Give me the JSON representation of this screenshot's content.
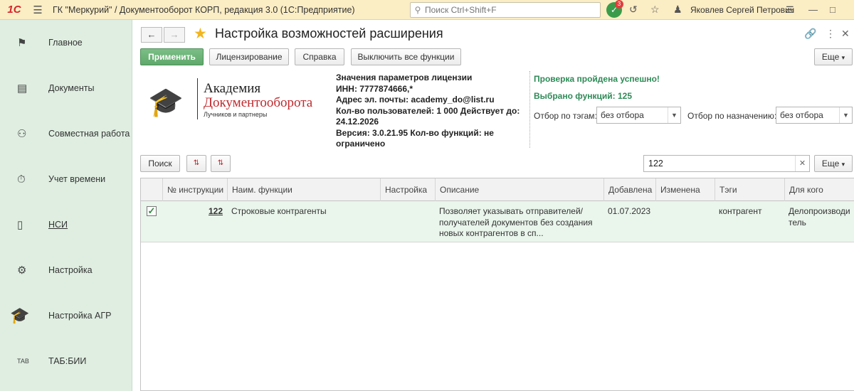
{
  "topbar": {
    "logo": "1С",
    "menu_icon": "hamburger-icon",
    "title": "ГК \"Меркурий\" / Документооборот КОРП, редакция 3.0  (1С:Предприятие)",
    "search_placeholder": "Поиск Ctrl+Shift+F",
    "notifications_count": "3",
    "user_name": "Яковлев Сергей Петрович"
  },
  "sidebar": {
    "items": [
      {
        "label": "Главное",
        "icon": "flag-icon"
      },
      {
        "label": "Документы",
        "icon": "folder-icon"
      },
      {
        "label": "Совместная работа",
        "icon": "users-icon"
      },
      {
        "label": "Учет времени",
        "icon": "clock-icon"
      },
      {
        "label": "НСИ",
        "icon": "book-icon"
      },
      {
        "label": "Настройка",
        "icon": "gear-icon"
      },
      {
        "label": "Настройка АГР",
        "icon": "graduation-cap-icon"
      },
      {
        "label": "ТАБ:БИИ",
        "icon": "tab-icon"
      }
    ]
  },
  "form": {
    "title": "Настройка возможностей расширения",
    "buttons": {
      "apply": "Применить",
      "licensing": "Лицензирование",
      "help": "Справка",
      "disable_all": "Выключить все функции",
      "more": "Еще"
    }
  },
  "academy": {
    "name_line1": "Академия",
    "name_line2": "Документооборота",
    "subtitle": "Лучников и партнеры"
  },
  "license": {
    "line1": "Значения параметров лицензии",
    "line2": "ИНН: 7777874666,*",
    "line3": "Адрес эл. почты: academy_do@list.ru",
    "line4": "Кол-во пользователей: 1 000 Действует до: 24.12.2026",
    "line5": "Версия: 3.0.21.95 Кол-во функций: не ограничено"
  },
  "status": {
    "check": "Проверка пройдена успешно!",
    "selected": "Выбрано функций: 125"
  },
  "filters": {
    "tags_label": "Отбор по тэгам:",
    "tags_value": "без отбора",
    "purpose_label": "Отбор по назначению:",
    "purpose_value": "без отбора"
  },
  "list_toolbar": {
    "search": "Поиск",
    "search_value": "122",
    "more": "Еще"
  },
  "table": {
    "columns": [
      "№ инструкции",
      "Наим. функции",
      "Настройка",
      "Описание",
      "Добавлена",
      "Изменена",
      "Тэги",
      "Для кого"
    ],
    "rows": [
      {
        "checked": true,
        "number": "122",
        "name": "Строковые контрагенты",
        "setting": "",
        "description": "Позволяет указывать отправителей/получателей документов без создания новых контрагентов в сп...",
        "added": "01.07.2023",
        "changed": "",
        "tags": "контрагент",
        "for_whom": "Делопроизводитель"
      }
    ]
  }
}
